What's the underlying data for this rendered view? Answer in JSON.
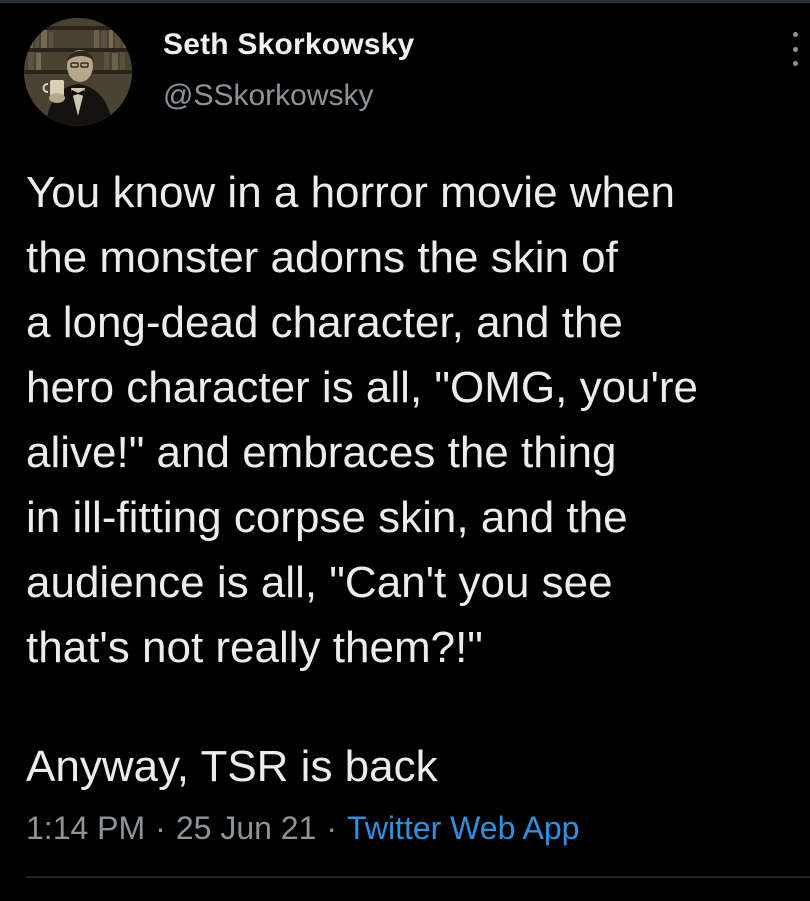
{
  "colors": {
    "background": "#000000",
    "text_primary": "#ececec",
    "text_secondary": "#8d9399",
    "link": "#2f8fe0",
    "divider": "#1f2328"
  },
  "tweet": {
    "author": {
      "name": "Seth Skorkowsky",
      "handle": "@SSkorkowsky",
      "avatar_icon": "sepia-portrait-avatar"
    },
    "menu_icon": "vertical-ellipsis-icon",
    "body_lines": [
      "You know in a horror movie when",
      "the monster adorns the skin of",
      "a long-dead character, and the",
      "hero character is all, \"OMG, you're",
      "alive!\" and embraces the thing",
      "in ill-fitting corpse skin, and the",
      "audience is all, \"Can't you see",
      "that's not really them?!\""
    ],
    "coda": "Anyway, TSR is back",
    "meta": {
      "time": "1:14 PM",
      "date": "25 Jun 21",
      "separator": "·",
      "source": "Twitter Web App"
    }
  }
}
